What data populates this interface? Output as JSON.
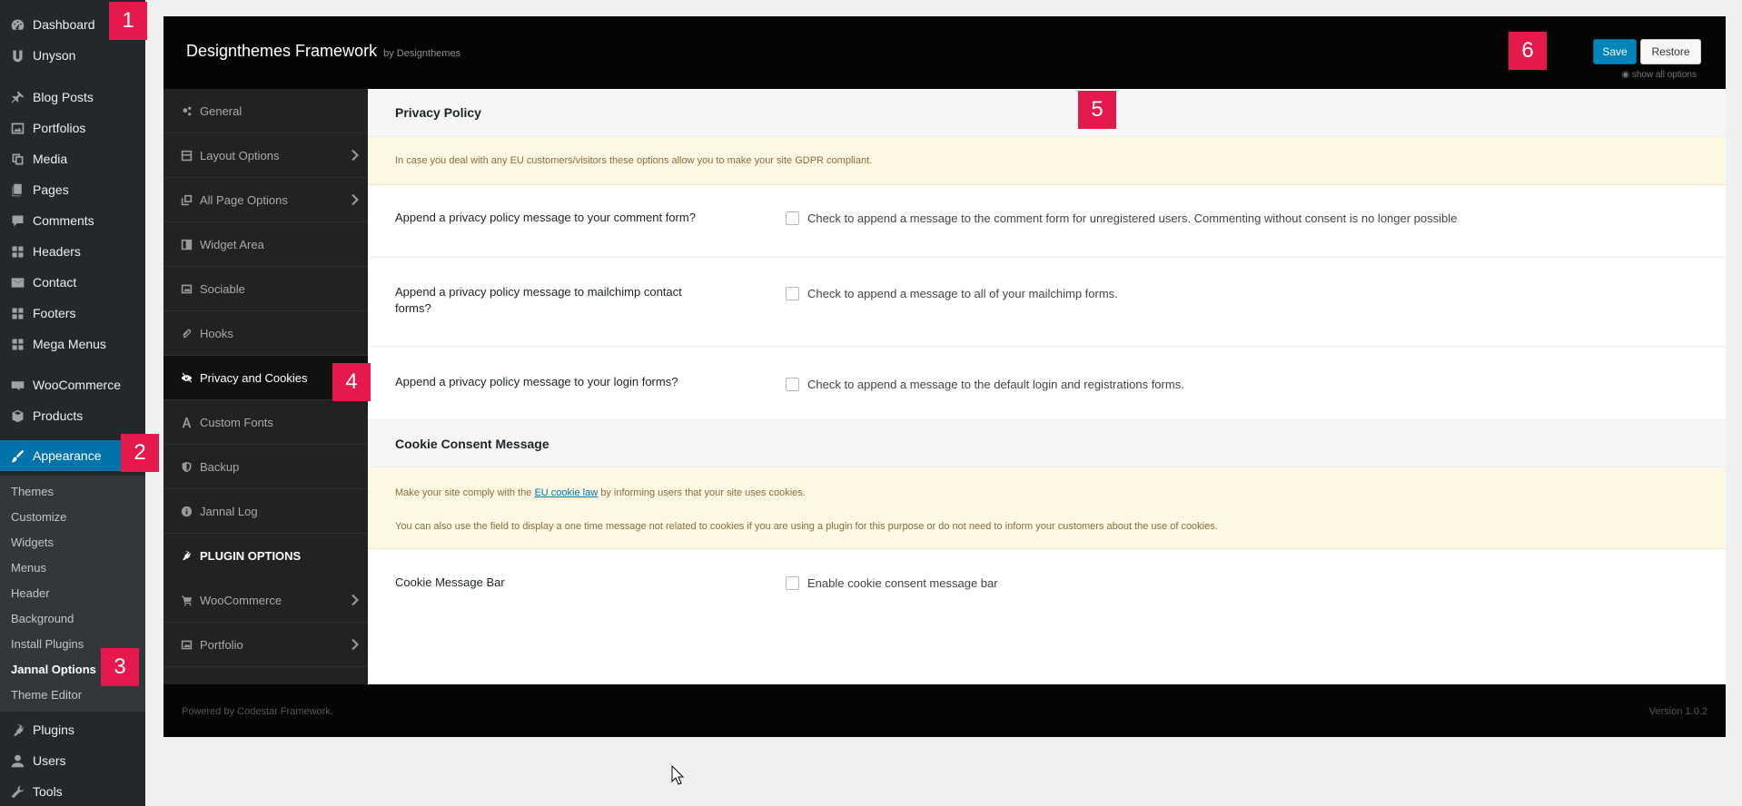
{
  "wp_menu": {
    "items": [
      {
        "label": "Dashboard",
        "icon": "dashboard-icon"
      },
      {
        "label": "Unyson",
        "icon": "unyson-icon"
      },
      {
        "label": "Blog Posts",
        "icon": "pin-icon"
      },
      {
        "label": "Portfolios",
        "icon": "image-icon"
      },
      {
        "label": "Media",
        "icon": "media-icon"
      },
      {
        "label": "Pages",
        "icon": "pages-icon"
      },
      {
        "label": "Comments",
        "icon": "comment-icon"
      },
      {
        "label": "Headers",
        "icon": "grid-icon"
      },
      {
        "label": "Contact",
        "icon": "mail-icon"
      },
      {
        "label": "Footers",
        "icon": "grid-icon"
      },
      {
        "label": "Mega Menus",
        "icon": "grid-icon"
      },
      {
        "label": "WooCommerce",
        "icon": "woo-icon"
      },
      {
        "label": "Products",
        "icon": "box-icon"
      },
      {
        "label": "Appearance",
        "icon": "brush-icon"
      },
      {
        "label": "Plugins",
        "icon": "plug-icon"
      },
      {
        "label": "Users",
        "icon": "user-icon"
      },
      {
        "label": "Tools",
        "icon": "wrench-icon"
      }
    ],
    "submenu": [
      "Themes",
      "Customize",
      "Widgets",
      "Menus",
      "Header",
      "Background",
      "Install Plugins",
      "Jannal Options",
      "Theme Editor"
    ],
    "current_submenu": "Jannal Options"
  },
  "framework": {
    "title": "Designthemes Framework",
    "by": "by Designthemes",
    "save_label": "Save",
    "restore_label": "Restore",
    "show_all": "show all options",
    "nav": [
      {
        "label": "General",
        "icon": "gears-icon",
        "arrow": false
      },
      {
        "label": "Layout Options",
        "icon": "layout-icon",
        "arrow": true
      },
      {
        "label": "All Page Options",
        "icon": "copy-icon",
        "arrow": true
      },
      {
        "label": "Widget Area",
        "icon": "widget-icon",
        "arrow": false
      },
      {
        "label": "Sociable",
        "icon": "picture-icon",
        "arrow": false
      },
      {
        "label": "Hooks",
        "icon": "paperclip-icon",
        "arrow": false
      },
      {
        "label": "Privacy and Cookies",
        "icon": "eye-slash-icon",
        "arrow": false
      },
      {
        "label": "Custom Fonts",
        "icon": "font-icon",
        "arrow": false
      },
      {
        "label": "Backup",
        "icon": "shield-icon",
        "arrow": false
      },
      {
        "label": "Jannal Log",
        "icon": "info-icon",
        "arrow": false
      }
    ],
    "plugin_heading": "PLUGIN OPTIONS",
    "plugin_nav": [
      {
        "label": "WooCommerce",
        "icon": "cart-icon",
        "arrow": true
      },
      {
        "label": "Portfolio",
        "icon": "gallery-icon",
        "arrow": true
      }
    ],
    "content": {
      "privacy_heading": "Privacy Policy",
      "privacy_notice": "In case you deal with any EU customers/visitors these options allow you to make your site GDPR compliant.",
      "options": [
        {
          "label": "Append a privacy policy message to your comment form?",
          "text": "Check to append a message to the comment form for unregistered users. Commenting without consent is no longer possible"
        },
        {
          "label_line1": "Append a privacy policy message to mailchimp contact",
          "label_line2": "forms?",
          "text": "Check to append a message to all of your mailchimp forms."
        },
        {
          "label": "Append a privacy policy message to your login forms?",
          "text": "Check to append a message to the default login and registrations forms."
        }
      ],
      "cookie_heading": "Cookie Consent Message",
      "cookie_notice_pre": "Make your site comply with the ",
      "cookie_notice_link": "EU cookie law",
      "cookie_notice_post": " by informing users that your site uses cookies.",
      "cookie_notice_2": "You can also use the field to display a one time message not related to cookies if you are using a plugin for this purpose or do not need to inform your customers about the use of cookies.",
      "cookie_bar_label": "Cookie Message Bar",
      "cookie_bar_text": "Enable cookie consent message bar"
    },
    "footer_powered": "Powered by Codestar Framework.",
    "footer_version": "Version 1.0.2"
  },
  "markers": [
    "1",
    "2",
    "3",
    "4",
    "5",
    "6"
  ]
}
